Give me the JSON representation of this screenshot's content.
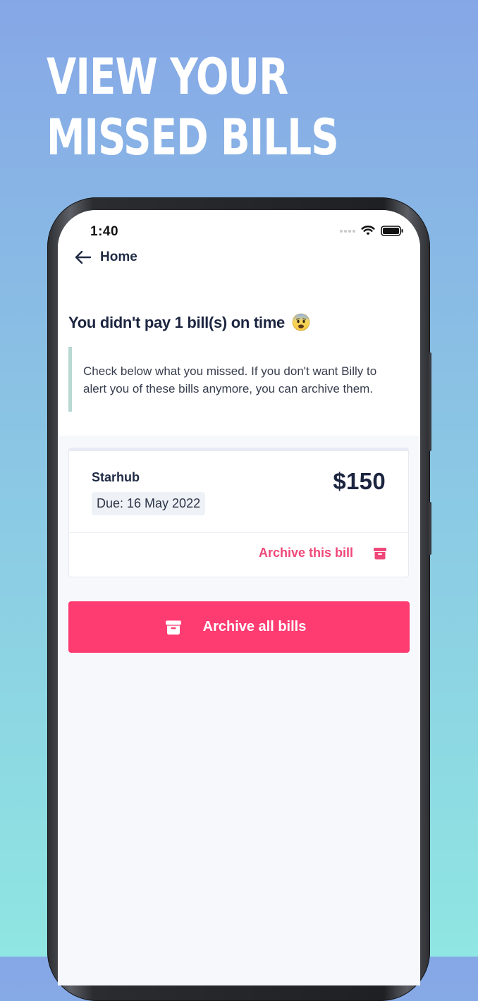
{
  "headline": {
    "line1": "VIEW YOUR",
    "line2": "MISSED BILLS"
  },
  "status_bar": {
    "time": "1:40"
  },
  "nav": {
    "back_label": "Home"
  },
  "page": {
    "title": "You didn't pay 1 bill(s) on time",
    "title_emoji": "anxious-face-with-sweat-emoji",
    "notice": "Check below what you missed. If you don't want Billy to alert you of these bills anymore, you can archive them."
  },
  "bills": [
    {
      "name": "Starhub",
      "due": "Due: 16 May 2022",
      "amount": "$150",
      "archive_label": "Archive this bill"
    }
  ],
  "actions": {
    "archive_all_label": "Archive all bills"
  },
  "colors": {
    "accent": "#fe3c72",
    "accent_text": "#f0487a",
    "title_text": "#1c2540",
    "notice_border": "#b8d8d2"
  },
  "icons": {
    "back": "arrow-left-icon",
    "archive": "archive-box-icon",
    "wifi": "wifi-icon",
    "battery": "battery-icon",
    "signal": "signal-icon"
  }
}
